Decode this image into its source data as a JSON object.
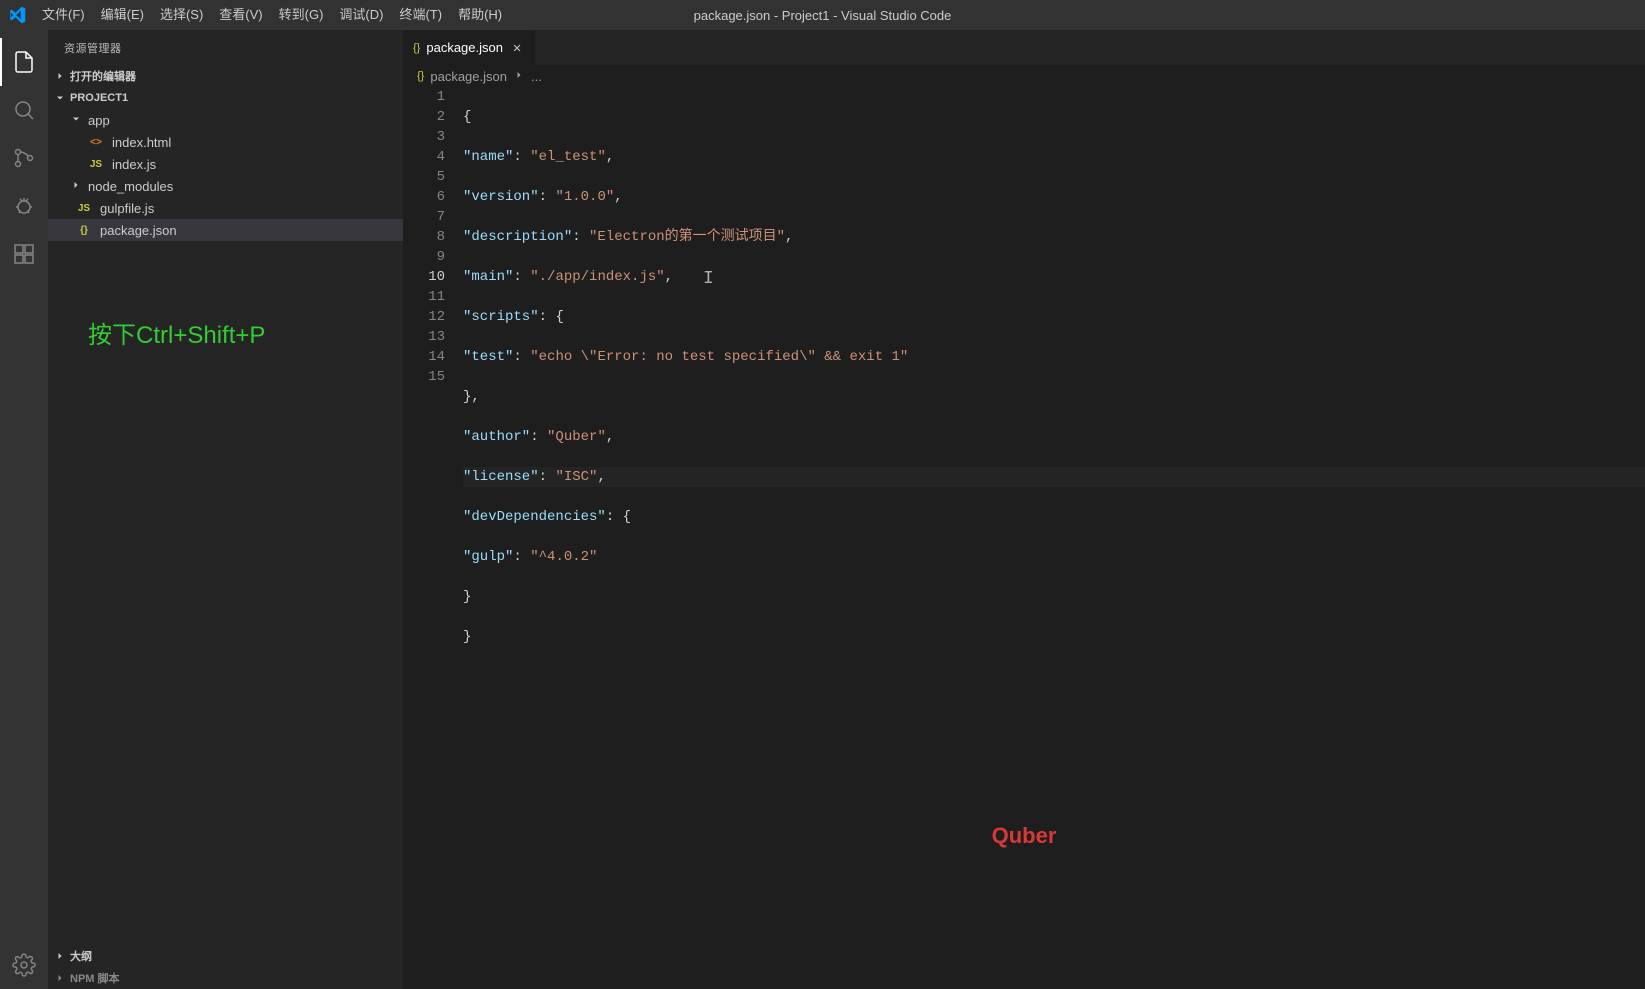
{
  "titlebar": {
    "title": "package.json - Project1 - Visual Studio Code"
  },
  "menu": {
    "file": "文件(F)",
    "edit": "编辑(E)",
    "selection": "选择(S)",
    "view": "查看(V)",
    "go": "转到(G)",
    "debug": "调试(D)",
    "terminal": "终端(T)",
    "help": "帮助(H)"
  },
  "sidebar": {
    "title": "资源管理器",
    "sections": {
      "openEditors": "打开的编辑器",
      "project": "PROJECT1",
      "outline": "大纲",
      "npmScripts": "NPM 脚本"
    },
    "tree": {
      "app": "app",
      "indexHtml": "index.html",
      "indexJs": "index.js",
      "nodeModules": "node_modules",
      "gulpfile": "gulpfile.js",
      "packageJson": "package.json"
    },
    "hint": "按下Ctrl+Shift+P"
  },
  "tabs": {
    "packageJson": "package.json"
  },
  "breadcrumb": {
    "file": "package.json",
    "more": "..."
  },
  "code": {
    "name_key": "\"name\"",
    "name_val": "\"el_test\"",
    "version_key": "\"version\"",
    "version_val": "\"1.0.0\"",
    "description_key": "\"description\"",
    "description_val": "\"Electron的第一个测试项目\"",
    "main_key": "\"main\"",
    "main_val": "\"./app/index.js\"",
    "scripts_key": "\"scripts\"",
    "test_key": "\"test\"",
    "test_val": "\"echo \\\"Error: no test specified\\\" && exit 1\"",
    "author_key": "\"author\"",
    "author_val": "\"Quber\"",
    "license_key": "\"license\"",
    "license_val": "\"ISC\"",
    "devdeps_key": "\"devDependencies\"",
    "gulp_key": "\"gulp\"",
    "gulp_val": "\"^4.0.2\""
  },
  "lineNumbers": [
    "1",
    "2",
    "3",
    "4",
    "5",
    "6",
    "7",
    "8",
    "9",
    "10",
    "11",
    "12",
    "13",
    "14",
    "15"
  ],
  "watermark": "Quber"
}
